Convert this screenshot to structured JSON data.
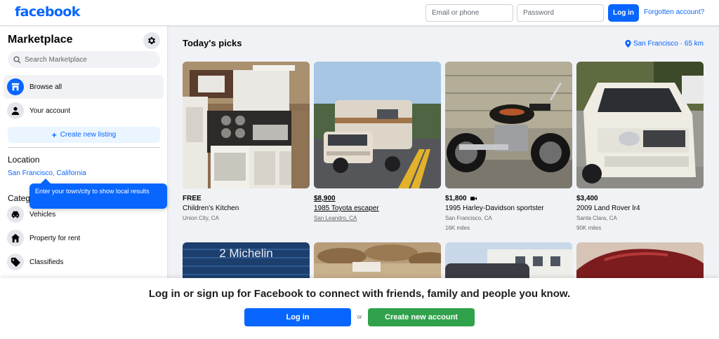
{
  "header": {
    "logo": "facebook",
    "email_placeholder": "Email or phone",
    "password_placeholder": "Password",
    "login_label": "Log in",
    "forgot_label": "Forgotten account?"
  },
  "sidebar": {
    "title": "Marketplace",
    "search_placeholder": "Search Marketplace",
    "nav": [
      {
        "label": "Browse all",
        "icon": "storefront-icon"
      },
      {
        "label": "Your account",
        "icon": "person-icon"
      }
    ],
    "create_listing": "Create new listing",
    "location_heading": "Location",
    "location_value": "San Francisco, California",
    "tooltip": "Enter your town/city to show local results",
    "categories_heading": "Categories",
    "categories": [
      {
        "label": "Vehicles",
        "icon": "car-icon"
      },
      {
        "label": "Property for rent",
        "icon": "house-icon"
      },
      {
        "label": "Classifieds",
        "icon": "tag-icon"
      }
    ]
  },
  "main": {
    "title": "Today's picks",
    "location_link": "San Francisco · 65 km",
    "listings": [
      {
        "price": "FREE",
        "title": "Children's Kitchen",
        "location": "Union City, CA",
        "miles": ""
      },
      {
        "price": "$8,900",
        "title": "1985 Toyota escaper",
        "location": "San Leandro, CA",
        "miles": ""
      },
      {
        "price": "$1,800",
        "title": "1995 Harley-Davidson sportster",
        "location": "San Francisco, CA",
        "miles": "16K miles"
      },
      {
        "price": "$3,400",
        "title": "2009 Land Rover lr4",
        "location": "Santa Clara, CA",
        "miles": "90K miles"
      }
    ],
    "tire_text": "2 Michelin"
  },
  "bottom": {
    "message": "Log in or sign up for Facebook to connect with friends, family and people you know.",
    "login_label": "Log in",
    "or_label": "or",
    "create_label": "Create new account"
  },
  "colors": {
    "brand": "#0866ff",
    "create_green": "#31a24c",
    "background": "#f0f2f5"
  }
}
